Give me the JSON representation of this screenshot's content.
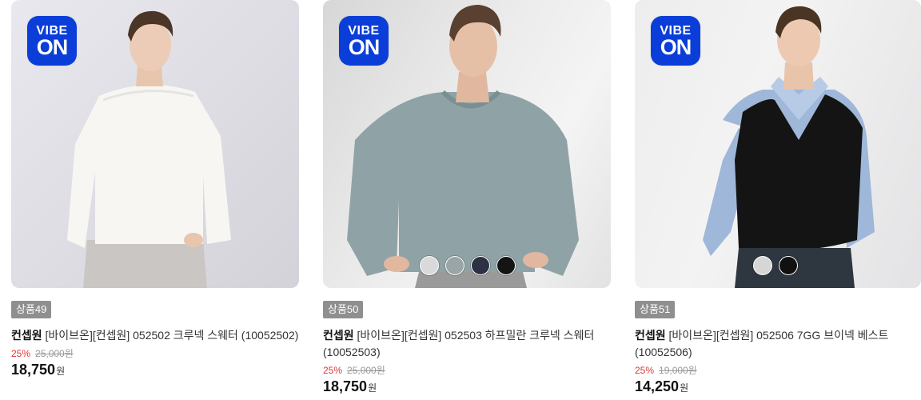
{
  "products": [
    {
      "badge": "상품49",
      "brand": "컨셉원",
      "name": "[바이브온][컨셉원] 052502 크루넥 스웨터 (10052502)",
      "discount_rate": "25%",
      "original_price": "25,000원",
      "price": "18,750",
      "currency": "원",
      "logo": {
        "line1": "VIBE",
        "line2": "ON"
      },
      "swatches": []
    },
    {
      "badge": "상품50",
      "brand": "컨셉원",
      "name": "[바이브온][컨셉원] 052503 하프밀란 크루넥 스웨터 (10052503)",
      "discount_rate": "25%",
      "original_price": "25,000원",
      "price": "18,750",
      "currency": "원",
      "logo": {
        "line1": "VIBE",
        "line2": "ON"
      },
      "swatches": [
        "#d9d9dc",
        "#9aa5a8",
        "#2c3244",
        "#141414"
      ]
    },
    {
      "badge": "상품51",
      "brand": "컨셉원",
      "name": "[바이브온][컨셉원] 052506 7GG 브이넥 베스트 (10052506)",
      "discount_rate": "25%",
      "original_price": "19,000원",
      "price": "14,250",
      "currency": "원",
      "logo": {
        "line1": "VIBE",
        "line2": "ON"
      },
      "swatches": [
        "#d6d6d6",
        "#111111"
      ]
    }
  ],
  "colors": {
    "logo_blue": "#0b3ed8",
    "discount_red": "#e03535",
    "badge_gray": "#8f8f8f"
  }
}
